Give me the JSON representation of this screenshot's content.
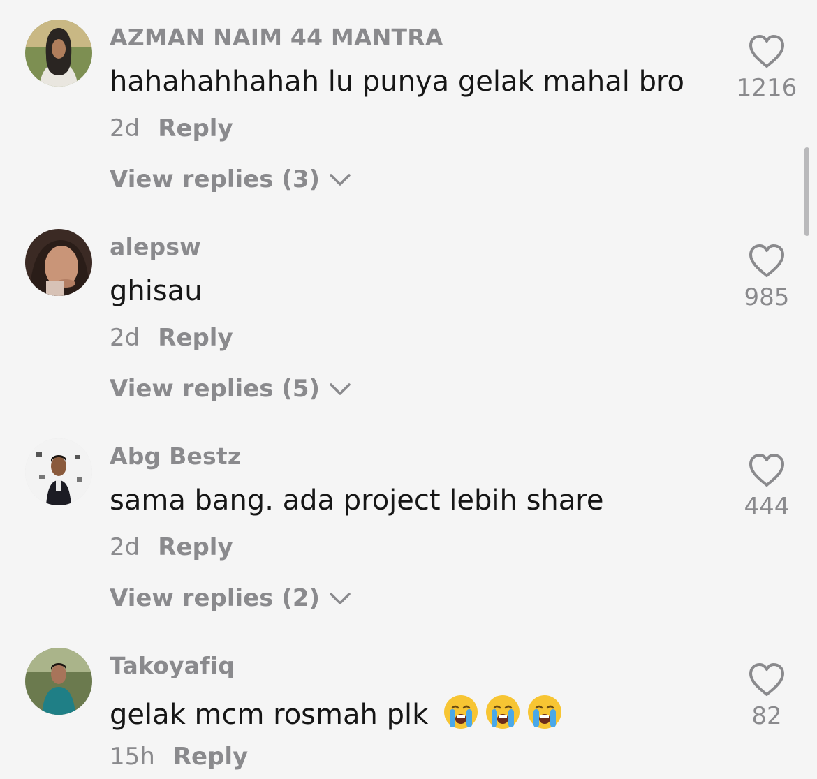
{
  "comments": [
    {
      "username": "AZMAN NAIM 44 MANTRA",
      "text": "hahahahhahah lu punya gelak mahal bro",
      "time": "2d",
      "reply_label": "Reply",
      "view_replies": "View replies (3)",
      "likes": "1216"
    },
    {
      "username": "alepsw",
      "text": "ghisau",
      "time": "2d",
      "reply_label": "Reply",
      "view_replies": "View replies (5)",
      "likes": "985"
    },
    {
      "username": "Abg Bestz",
      "text": "sama bang. ada project lebih share",
      "time": "2d",
      "reply_label": "Reply",
      "view_replies": "View replies (2)",
      "likes": "444"
    },
    {
      "username": "Takoyafiq",
      "text": "gelak mcm rosmah plk",
      "emojis": [
        "loudly-crying-face",
        "loudly-crying-face",
        "loudly-crying-face"
      ],
      "time": "15h",
      "reply_label": "Reply",
      "likes": "82"
    }
  ],
  "icons": {
    "like": "heart-outline-icon",
    "expand": "chevron-down-icon"
  },
  "colors": {
    "background": "#f5f5f5",
    "primary_text": "#161616",
    "secondary_text": "#8a8a8d",
    "scrollbar": "#b9b9bb"
  }
}
